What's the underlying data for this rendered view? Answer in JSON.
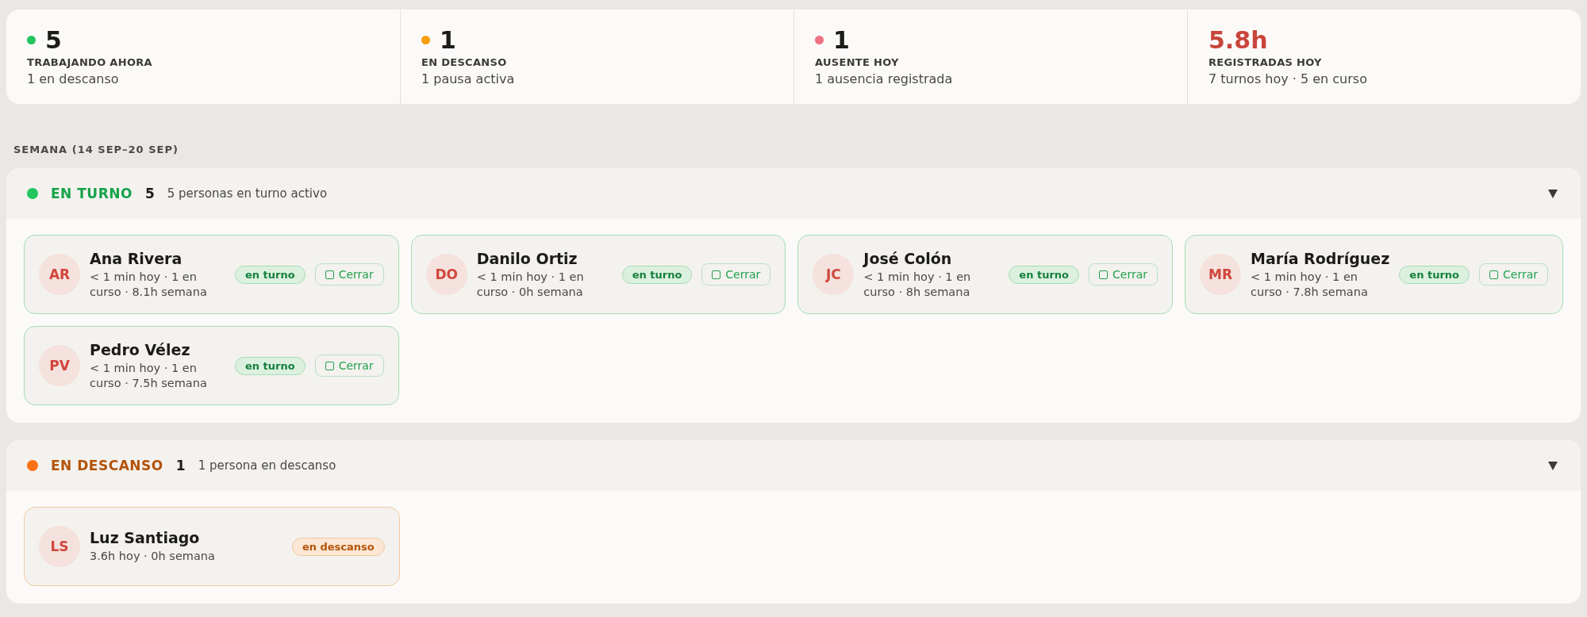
{
  "stats": [
    {
      "kind": "count",
      "color": "#22c55e",
      "value": "5",
      "label": "TRABAJANDO AHORA",
      "detail": "1 en descanso"
    },
    {
      "kind": "count",
      "color": "#f59e0b",
      "value": "1",
      "label": "EN DESCANSO",
      "detail": "1 pausa activa"
    },
    {
      "kind": "count",
      "color": "#f07282",
      "value": "1",
      "label": "AUSENTE HOY",
      "detail": "1 ausencia registrada"
    },
    {
      "kind": "hours",
      "value": "5.8h",
      "label": "REGISTRADAS HOY",
      "detail": "7 turnos hoy · 5 en curso"
    }
  ],
  "week_label": "SEMANA (14 SEP–20 SEP)",
  "sections": [
    {
      "kind": "working",
      "title": "EN TURNO",
      "count": "5",
      "description": "5 personas en turno activo",
      "expanded": true,
      "people": [
        {
          "initials": "AR",
          "name": "Ana Rivera",
          "detail": "< 1 min hoy · 1 en curso · 8.1h semana",
          "status": "en turno",
          "action": "Cerrar"
        },
        {
          "initials": "DO",
          "name": "Danilo Ortiz",
          "detail": "< 1 min hoy · 1 en curso · 0h semana",
          "status": "en turno",
          "action": "Cerrar"
        },
        {
          "initials": "JC",
          "name": "José Colón",
          "detail": "< 1 min hoy · 1 en curso · 8h semana",
          "status": "en turno",
          "action": "Cerrar"
        },
        {
          "initials": "MR",
          "name": "María Rodríguez",
          "detail": "< 1 min hoy · 1 en curso · 7.8h semana",
          "status": "en turno",
          "action": "Cerrar"
        },
        {
          "initials": "PV",
          "name": "Pedro Vélez",
          "detail": "< 1 min hoy · 1 en curso · 7.5h semana",
          "status": "en turno",
          "action": "Cerrar"
        }
      ]
    },
    {
      "kind": "break",
      "title": "EN DESCANSO",
      "count": "1",
      "description": "1 persona en descanso",
      "expanded": true,
      "people": [
        {
          "initials": "LS",
          "name": "Luz Santiago",
          "detail": "3.6h hoy · 0h semana",
          "status": "en descanso"
        }
      ]
    }
  ]
}
